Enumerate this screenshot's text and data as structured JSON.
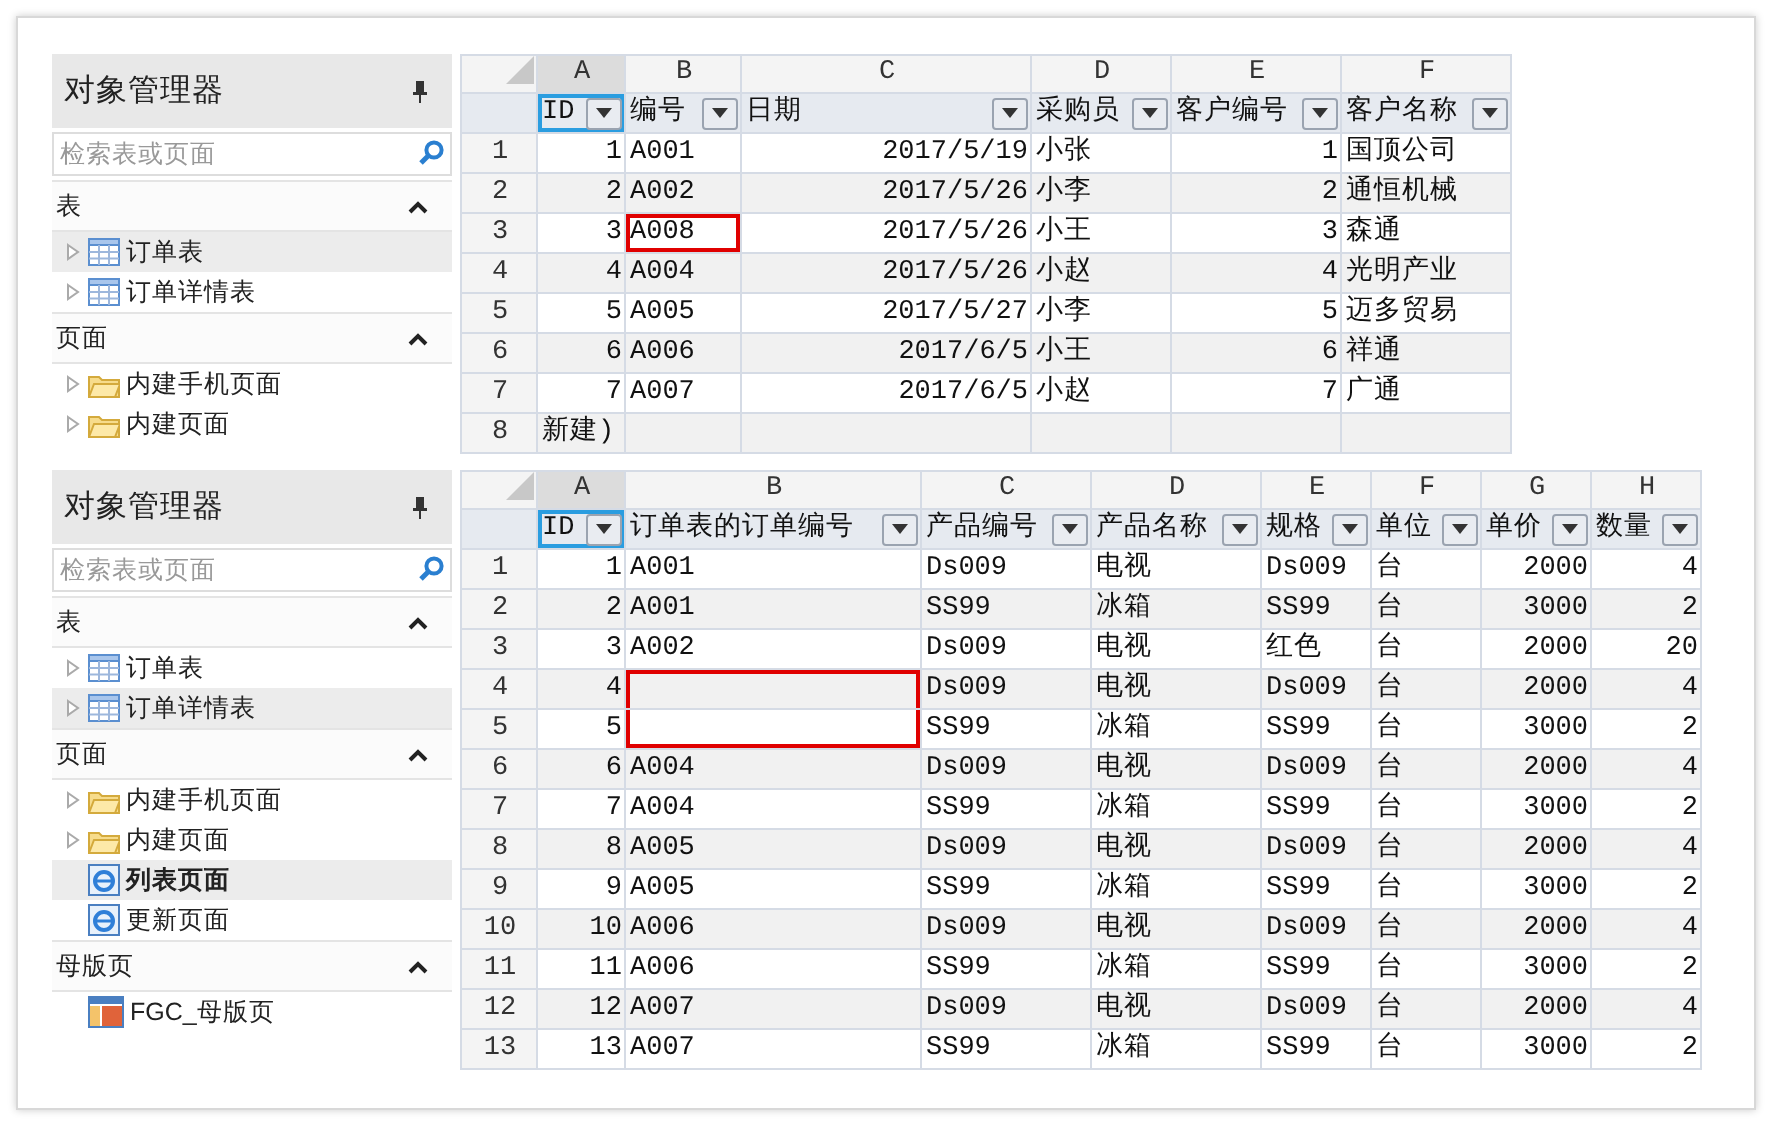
{
  "panels": [
    {
      "object_manager": {
        "title": "对象管理器",
        "search": {
          "placeholder": "检索表或页面"
        },
        "sections": [
          {
            "title": "表",
            "expanded": true,
            "items": [
              {
                "kind": "table",
                "label": "订单表",
                "selected": true,
                "current": false
              },
              {
                "kind": "table",
                "label": "订单详情表",
                "selected": false,
                "current": false
              }
            ]
          },
          {
            "title": "页面",
            "expanded": true,
            "items": [
              {
                "kind": "folder",
                "label": "内建手机页面",
                "selected": false,
                "current": false
              },
              {
                "kind": "folder",
                "label": "内建页面",
                "selected": false,
                "current": false
              }
            ]
          }
        ]
      },
      "grid": {
        "columns": [
          {
            "letter": "A",
            "field": "ID",
            "kind": "number",
            "selected": true
          },
          {
            "letter": "B",
            "field": "编号",
            "kind": "text",
            "selected": false
          },
          {
            "letter": "C",
            "field": "日期",
            "kind": "number",
            "selected": false
          },
          {
            "letter": "D",
            "field": "采购员",
            "kind": "text",
            "selected": false
          },
          {
            "letter": "E",
            "field": "客户编号",
            "kind": "number",
            "selected": false
          },
          {
            "letter": "F",
            "field": "客户名称",
            "kind": "text",
            "selected": false
          }
        ],
        "rows": [
          {
            "kind": "data",
            "number": "1",
            "cells": [
              "1",
              "A001",
              "2017/5/19",
              "小张",
              "1",
              "国顶公司"
            ]
          },
          {
            "kind": "data",
            "number": "2",
            "cells": [
              "2",
              "A002",
              "2017/5/26",
              "小李",
              "2",
              "通恒机械"
            ]
          },
          {
            "kind": "data",
            "number": "3",
            "cells": [
              "3",
              {
                "text": "A008",
                "highlighted": true
              },
              "2017/5/26",
              "小王",
              "3",
              "森通"
            ]
          },
          {
            "kind": "data",
            "number": "4",
            "cells": [
              "4",
              "A004",
              "2017/5/26",
              "小赵",
              "4",
              "光明产业"
            ]
          },
          {
            "kind": "data",
            "number": "5",
            "cells": [
              "5",
              "A005",
              "2017/5/27",
              "小李",
              "5",
              "迈多贸易"
            ]
          },
          {
            "kind": "data",
            "number": "6",
            "cells": [
              "6",
              "A006",
              "2017/6/5",
              "小王",
              "6",
              "祥通"
            ]
          },
          {
            "kind": "data",
            "number": "7",
            "cells": [
              "7",
              "A007",
              "2017/6/5",
              "小赵",
              "7",
              "广通"
            ]
          },
          {
            "kind": "new",
            "number": "8",
            "label": "新建)"
          }
        ]
      }
    },
    {
      "object_manager": {
        "title": "对象管理器",
        "search": {
          "placeholder": "检索表或页面"
        },
        "sections": [
          {
            "title": "表",
            "expanded": true,
            "items": [
              {
                "kind": "table",
                "label": "订单表",
                "selected": false,
                "current": false
              },
              {
                "kind": "table",
                "label": "订单详情表",
                "selected": true,
                "current": false
              }
            ]
          },
          {
            "title": "页面",
            "expanded": true,
            "items": [
              {
                "kind": "folder",
                "label": "内建手机页面",
                "selected": false,
                "current": false
              },
              {
                "kind": "folder",
                "label": "内建页面",
                "selected": false,
                "current": false
              },
              {
                "kind": "page",
                "label": "列表页面",
                "selected": true,
                "current": true
              },
              {
                "kind": "page",
                "label": "更新页面",
                "selected": false,
                "current": false
              }
            ]
          },
          {
            "title": "母版页",
            "expanded": true,
            "items": [
              {
                "kind": "master",
                "label": "FGC_母版页",
                "selected": false,
                "current": false
              }
            ]
          }
        ]
      },
      "grid": {
        "columns": [
          {
            "letter": "A",
            "field": "ID",
            "kind": "number",
            "selected": true
          },
          {
            "letter": "B",
            "field": "订单表的订单编号",
            "kind": "text",
            "selected": false
          },
          {
            "letter": "C",
            "field": "产品编号",
            "kind": "text",
            "selected": false
          },
          {
            "letter": "D",
            "field": "产品名称",
            "kind": "text",
            "selected": false
          },
          {
            "letter": "E",
            "field": "规格",
            "kind": "text",
            "selected": false
          },
          {
            "letter": "F",
            "field": "单位",
            "kind": "text",
            "selected": false
          },
          {
            "letter": "G",
            "field": "单价",
            "kind": "number",
            "selected": false
          },
          {
            "letter": "H",
            "field": "数量",
            "kind": "number",
            "selected": false
          }
        ],
        "rows": [
          {
            "kind": "data",
            "number": "1",
            "cells": [
              "1",
              "A001",
              "Ds009",
              "电视",
              "Ds009",
              "台",
              "2000",
              "4"
            ]
          },
          {
            "kind": "data",
            "number": "2",
            "cells": [
              "2",
              "A001",
              "SS99",
              "冰箱",
              "SS99",
              "台",
              "3000",
              "2"
            ]
          },
          {
            "kind": "data",
            "number": "3",
            "cells": [
              "3",
              "A002",
              "Ds009",
              "电视",
              "红色",
              "台",
              "2000",
              "20"
            ]
          },
          {
            "kind": "data",
            "number": "4",
            "cells": [
              "4",
              {
                "highlighted": true
              },
              "Ds009",
              "电视",
              "Ds009",
              "台",
              "2000",
              "4"
            ]
          },
          {
            "kind": "data",
            "number": "5",
            "cells": [
              "5",
              {
                "highlighted": true
              },
              "SS99",
              "冰箱",
              "SS99",
              "台",
              "3000",
              "2"
            ]
          },
          {
            "kind": "data",
            "number": "6",
            "cells": [
              "6",
              "A004",
              "Ds009",
              "电视",
              "Ds009",
              "台",
              "2000",
              "4"
            ]
          },
          {
            "kind": "data",
            "number": "7",
            "cells": [
              "7",
              "A004",
              "SS99",
              "冰箱",
              "SS99",
              "台",
              "3000",
              "2"
            ]
          },
          {
            "kind": "data",
            "number": "8",
            "cells": [
              "8",
              "A005",
              "Ds009",
              "电视",
              "Ds009",
              "台",
              "2000",
              "4"
            ]
          },
          {
            "kind": "data",
            "number": "9",
            "cells": [
              "9",
              "A005",
              "SS99",
              "冰箱",
              "SS99",
              "台",
              "3000",
              "2"
            ]
          },
          {
            "kind": "data",
            "number": "10",
            "cells": [
              "10",
              "A006",
              "Ds009",
              "电视",
              "Ds009",
              "台",
              "2000",
              "4"
            ]
          },
          {
            "kind": "data",
            "number": "11",
            "cells": [
              "11",
              "A006",
              "SS99",
              "冰箱",
              "SS99",
              "台",
              "3000",
              "2"
            ]
          },
          {
            "kind": "data",
            "number": "12",
            "cells": [
              "12",
              "A007",
              "Ds009",
              "电视",
              "Ds009",
              "台",
              "2000",
              "4"
            ]
          },
          {
            "kind": "data",
            "number": "13",
            "cells": [
              "13",
              "A007",
              "SS99",
              "冰箱",
              "SS99",
              "台",
              "3000",
              "2"
            ]
          }
        ]
      }
    }
  ]
}
